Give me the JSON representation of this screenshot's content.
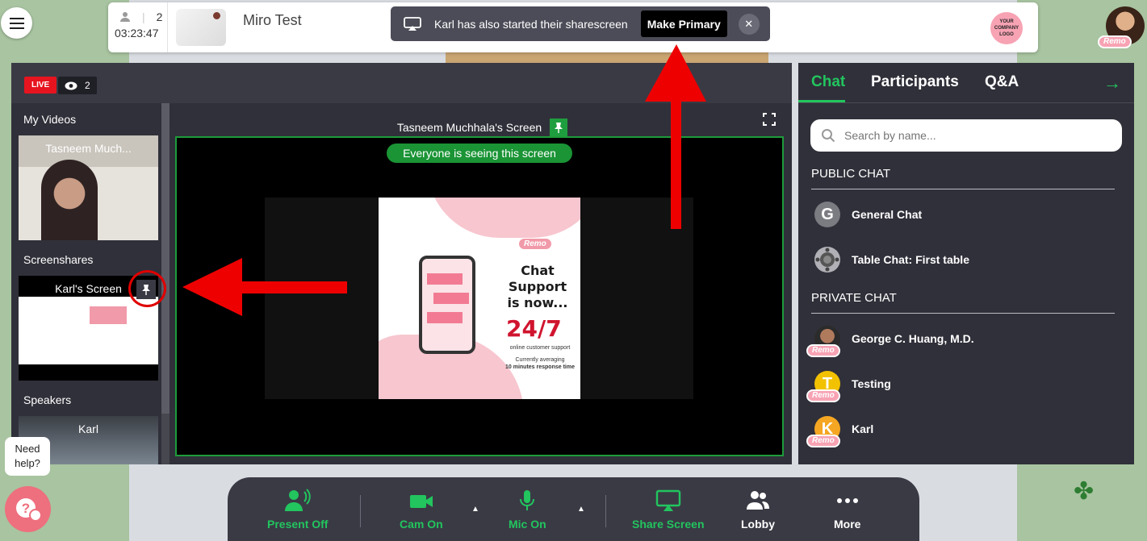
{
  "topbar": {
    "attendee_count": "2",
    "timer": "03:23:47",
    "room_title": "Miro Test",
    "logo_text": "YOUR COMPANY LOGO"
  },
  "notification": {
    "message": "Karl has also started their sharescreen",
    "primary_button": "Make Primary"
  },
  "user": {
    "badge": "Remo"
  },
  "stage": {
    "live_label": "LIVE",
    "viewer_count": "2",
    "sections": {
      "my_videos": "My Videos",
      "screenshares": "Screenshares",
      "speakers": "Speakers"
    },
    "my_video_name": "Tasneem Much...",
    "screenshare_name": "Karl's Screen",
    "speaker_name": "Karl",
    "screen_title": "Tasneem Muchhala's Screen",
    "everyone_banner": "Everyone is seeing this screen"
  },
  "poster": {
    "brand": "Remo",
    "headline": "Chat Support is now...",
    "big": "24/7",
    "sub1": "online customer support",
    "sub2": "Currently averaging",
    "sub3": "10 minutes response time"
  },
  "panel": {
    "tabs": [
      "Chat",
      "Participants",
      "Q&A"
    ],
    "search_placeholder": "Search by name...",
    "public_header": "PUBLIC CHAT",
    "private_header": "PRIVATE CHAT",
    "public": [
      {
        "name": "General Chat",
        "initial": "G"
      },
      {
        "name": "Table Chat: First table"
      }
    ],
    "private": [
      {
        "name": "George C. Huang, M.D."
      },
      {
        "name": "Testing",
        "initial": "T"
      },
      {
        "name": "Karl",
        "initial": "K"
      }
    ]
  },
  "toolbar": {
    "present": "Present Off",
    "cam": "Cam On",
    "mic": "Mic On",
    "share": "Share Screen",
    "lobby": "Lobby",
    "more": "More"
  },
  "help": {
    "text": "Need help?"
  },
  "colors": {
    "accent_green": "#22c55e",
    "live_red": "#e6141e",
    "panel_bg": "#30303a",
    "brand_pink": "#f7a3b4"
  }
}
